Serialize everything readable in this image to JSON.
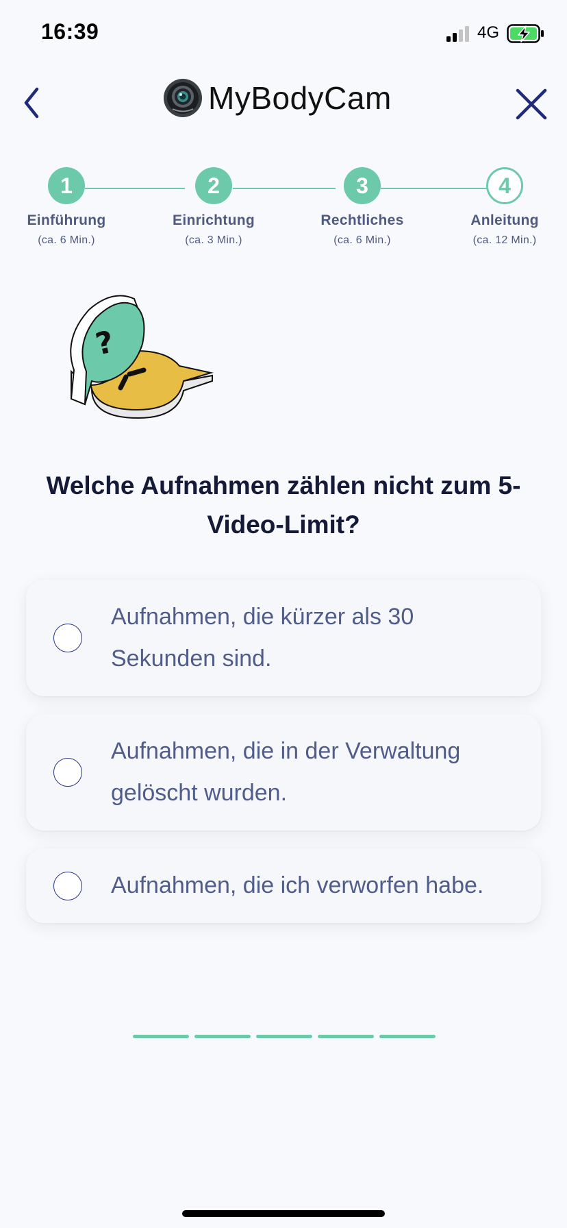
{
  "status_bar": {
    "time": "16:39",
    "network": "4G",
    "icons": [
      "signal-bars-icon",
      "battery-charging-icon"
    ]
  },
  "header": {
    "app_name": "MyBodyCam",
    "icons": [
      "chevron-left-icon",
      "camera-lens-logo",
      "close-icon"
    ],
    "colors": {
      "nav_icon": "#1f2a7a"
    }
  },
  "stepper": {
    "steps": [
      {
        "number": "1",
        "label": "Einführung",
        "duration": "(ca. 6 Min.)",
        "state": "completed"
      },
      {
        "number": "2",
        "label": "Einrichtung",
        "duration": "(ca. 3 Min.)",
        "state": "completed"
      },
      {
        "number": "3",
        "label": "Rechtliches",
        "duration": "(ca. 6 Min.)",
        "state": "completed"
      },
      {
        "number": "4",
        "label": "Anleitung",
        "duration": "(ca. 12 Min.)",
        "state": "current"
      }
    ],
    "colors": {
      "accent": "#6ccaaa",
      "label": "#4f5a80"
    }
  },
  "illustration": {
    "icon": "question-exclamation-bubbles-illustration"
  },
  "quiz": {
    "question": "Welche Aufnahmen zählen nicht zum 5-Video-Limit?",
    "options": [
      {
        "text": "Aufnahmen, die kürzer als 30 Sekunden sind.",
        "selected": false
      },
      {
        "text": "Aufnahmen, die in der Verwaltung gelöscht wurden.",
        "selected": false
      },
      {
        "text": "Aufnahmen, die ich verworfen habe.",
        "selected": false
      }
    ]
  },
  "progress": {
    "segments_total": 5,
    "segments_filled": 5,
    "color": "#6ccaaa"
  }
}
